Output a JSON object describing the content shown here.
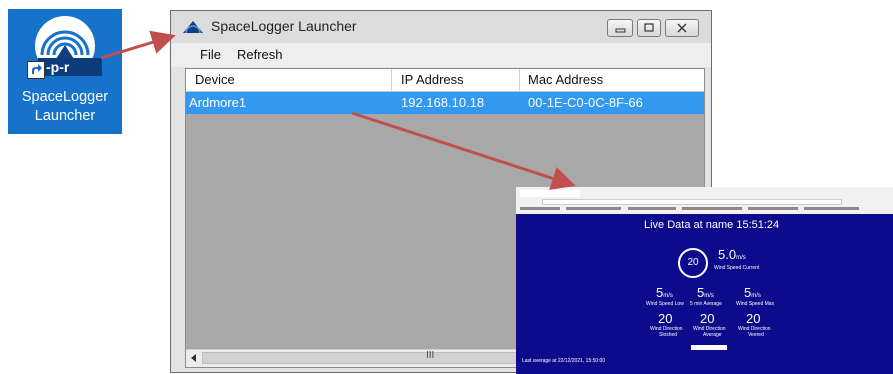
{
  "desktop_icon": {
    "badge_text": "-p-r",
    "label_line1": "SpaceLogger",
    "label_line2": "Launcher"
  },
  "window": {
    "title": "SpaceLogger Launcher",
    "menu": [
      "File",
      "Refresh"
    ],
    "columns": [
      "Device",
      "IP Address",
      "Mac Address"
    ],
    "rows": [
      {
        "device": "Ardmore1",
        "ip": "192.168.10.18",
        "mac": "00-1E-C0-0C-8F-66"
      }
    ],
    "scroll_grip": "III"
  },
  "browser": {
    "title": "Live Data at name   15:51:24",
    "gauge_value": "20",
    "wind_speed": "5.0",
    "wind_speed_unit": "m/s",
    "wind_speed_label": "Wind Speed Current",
    "stats": [
      {
        "value": "5",
        "unit": "m/s",
        "label": "Wind Speed Low"
      },
      {
        "value": "5",
        "unit": "m/s",
        "label": "5 min Average"
      },
      {
        "value": "5",
        "unit": "m/s",
        "label": "Wind Speed Max"
      }
    ],
    "directions": [
      {
        "value": "20",
        "label1": "Wind Direction",
        "label2": "Sloshed"
      },
      {
        "value": "20",
        "label1": "Wind Direction",
        "label2": "Average"
      },
      {
        "value": "20",
        "label1": "Wind Direction",
        "label2": "Veered"
      }
    ],
    "footer": "Last average at 22/12/2021, 15:50:00"
  },
  "colors": {
    "icon_bg": "#1673c9",
    "selection": "#3399ee",
    "browser_bg": "#0b0b8c",
    "arrow": "#c0504d"
  }
}
